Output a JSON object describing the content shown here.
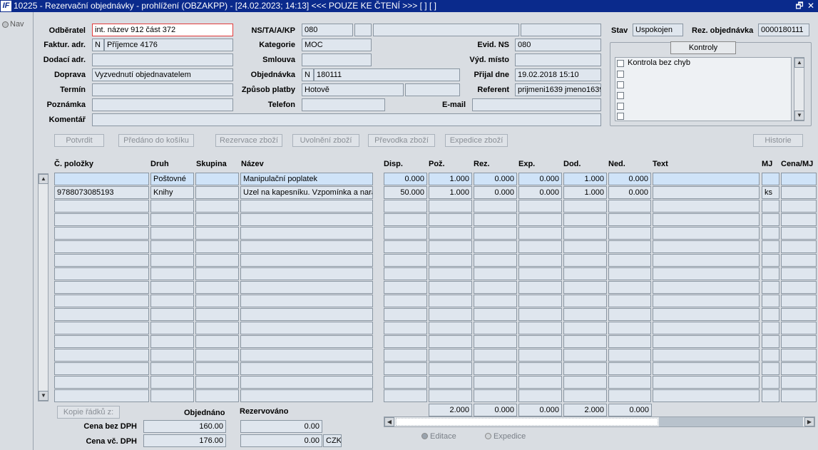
{
  "window": {
    "title": "10225 - Rezervační objednávky - prohlížení (OBZAKPP) - [24.02.2023; 14:13] <<< POUZE KE ČTENÍ >>> [ ] [ ]",
    "icon_text": "IF",
    "restore_glyph": "🗗",
    "close_glyph": "✕"
  },
  "nav": {
    "label": "Nav"
  },
  "form": {
    "odberatel": {
      "label": "Odběratel",
      "value": "int. název 912 část 372"
    },
    "faktur": {
      "label": "Faktur. adr.",
      "flag": "N",
      "value": "Příjemce 4176"
    },
    "dodaci": {
      "label": "Dodací adr.",
      "value": ""
    },
    "doprava": {
      "label": "Doprava",
      "value": "Vyzvednutí objednavatelem"
    },
    "termin": {
      "label": "Termín",
      "value": ""
    },
    "poznamka": {
      "label": "Poznámka",
      "value": ""
    },
    "komentar": {
      "label": "Komentář",
      "value": ""
    },
    "ns": {
      "label": "NS/TA/A/KP",
      "value1": "080",
      "value2": "",
      "value3": "",
      "value4": ""
    },
    "kategorie": {
      "label": "Kategorie",
      "value": "MOC"
    },
    "smlouva": {
      "label": "Smlouva",
      "value": ""
    },
    "objednavka": {
      "label": "Objednávka",
      "flag": "N",
      "value": "180111"
    },
    "zpusob_platby": {
      "label": "Způsob platby",
      "value": "Hotově",
      "value2": ""
    },
    "telefon": {
      "label": "Telefon",
      "value": ""
    },
    "evid_ns": {
      "label": "Evid. NS",
      "value": "080"
    },
    "vyd_misto": {
      "label": "Výd. místo",
      "value": ""
    },
    "prijal_dne": {
      "label": "Přijal dne",
      "value": "19.02.2018 15:10"
    },
    "referent": {
      "label": "Referent",
      "value": "prijmeni1639 jmeno1639"
    },
    "email": {
      "label": "E-mail",
      "value": ""
    },
    "stav": {
      "label": "Stav",
      "value": "Uspokojen"
    },
    "rez_objednavka": {
      "label": "Rez. objednávka",
      "value": "0000180111"
    }
  },
  "kontroly": {
    "button": "Kontroly",
    "items": [
      "Kontrola bez chyb",
      "",
      "",
      "",
      "",
      ""
    ]
  },
  "actions": {
    "potvrdit": "Potvrdit",
    "predano": "Předáno do košíku",
    "rezervace": "Rezervace zboží",
    "uvolneni": "Uvolnění zboží",
    "prevodka": "Převodka zboží",
    "expedice": "Expedice zboží",
    "historie": "Historie"
  },
  "grid": {
    "headers": [
      "Č. položky",
      "Druh",
      "Skupina",
      "Název",
      "Disp.",
      "Pož.",
      "Rez.",
      "Exp.",
      "Dod.",
      "Ned.",
      "Text",
      "MJ",
      "Cena/MJ"
    ],
    "rows": [
      [
        "",
        "Poštovné",
        "",
        "Manipulační poplatek",
        "0.000",
        "1.000",
        "0.000",
        "0.000",
        "1.000",
        "0.000",
        "",
        "",
        ""
      ],
      [
        "9788073085193",
        "Knihy",
        "",
        "Uzel na kapesníku. Vzpomínka a narat",
        "50.000",
        "1.000",
        "0.000",
        "0.000",
        "1.000",
        "0.000",
        "",
        "ks",
        ""
      ]
    ],
    "totals": [
      "2.000",
      "0.000",
      "0.000",
      "2.000",
      "0.000"
    ]
  },
  "bottom": {
    "kopie": "Kopie řádků z:",
    "objednano": "Objednáno",
    "rezervovano": "Rezervováno",
    "cena_bez_dph_label": "Cena bez DPH",
    "cena_bez_dph": "160.00",
    "cena_bez_dph_rez": "0.00",
    "cena_vc_dph_label": "Cena vč. DPH",
    "cena_vc_dph": "176.00",
    "cena_vc_dph_rez": "0.00",
    "mena": "CZK",
    "radio_editace": "Editace",
    "radio_expedice": "Expedice"
  }
}
